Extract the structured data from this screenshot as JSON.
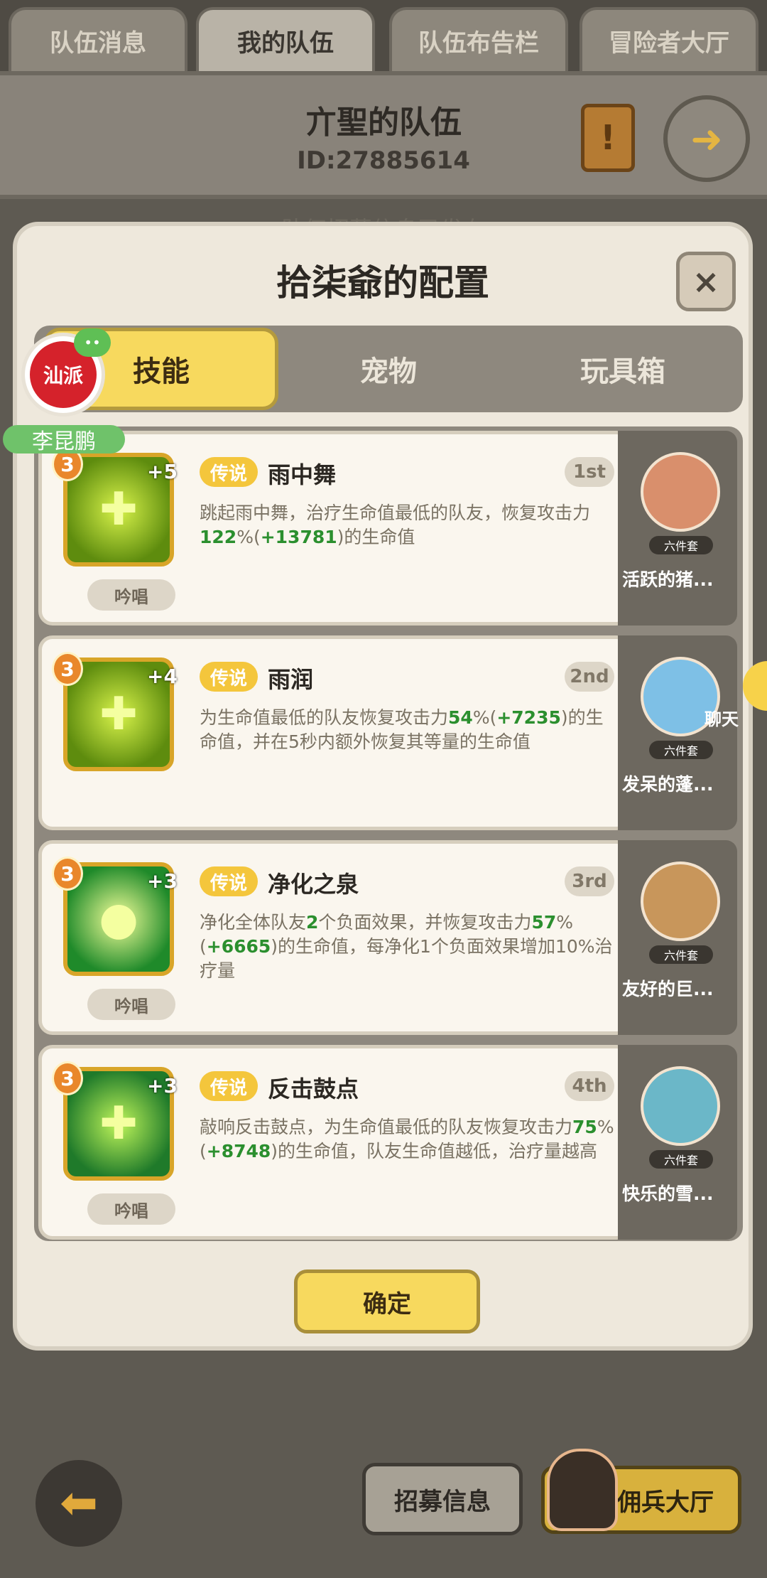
{
  "top_tabs": [
    "队伍消息",
    "我的队伍",
    "队伍布告栏",
    "冒险者大厅"
  ],
  "header": {
    "title": "亣聖的队伍",
    "id": "ID:27885614"
  },
  "faded_notice": "队伍招募信息已发布",
  "modal": {
    "title": "拾柒爺的配置",
    "close_label": "×",
    "tabs": [
      "技能",
      "宠物",
      "玩具箱"
    ],
    "skills": [
      {
        "rarity": "传说",
        "name": "雨中舞",
        "rank": "1st",
        "level": "3",
        "plus": "+5",
        "cast": "吟唱",
        "desc_parts": [
          "跳起雨中舞，治疗生命值最低的队友，恢复攻击力",
          "122",
          "%(",
          "+13781",
          ")的生命值"
        ]
      },
      {
        "rarity": "传说",
        "name": "雨润",
        "rank": "2nd",
        "level": "3",
        "plus": "+4",
        "cast": "",
        "desc_parts": [
          "为生命值最低的队友恢复攻击力",
          "54",
          "%(",
          "+7235",
          ")的生命值，并在5秒内额外恢复其等量的生命值"
        ]
      },
      {
        "rarity": "传说",
        "name": "净化之泉",
        "rank": "3rd",
        "level": "3",
        "plus": "+3",
        "cast": "吟唱",
        "desc_parts": [
          "净化全体队友",
          "2",
          "个负面效果，并恢复攻击力",
          "57",
          "%(",
          "+6665",
          ")的生命值，每净化1个负面效果增加10%治疗量"
        ]
      },
      {
        "rarity": "传说",
        "name": "反击鼓点",
        "rank": "4th",
        "level": "3",
        "plus": "+3",
        "cast": "吟唱",
        "desc_parts": [
          "敲响反击鼓点，为生命值最低的队友恢复攻击力",
          "75",
          "%(",
          "+8748",
          ")的生命值，队友生命值越低，治疗量越高"
        ]
      }
    ],
    "pets": [
      {
        "name": "活跃的猪...",
        "set_label": "六件套"
      },
      {
        "name": "发呆的蓬...",
        "set_label": "六件套"
      },
      {
        "name": "友好的巨...",
        "set_label": "六件套"
      },
      {
        "name": "快乐的雪...",
        "set_label": "六件套"
      }
    ],
    "confirm_label": "确定"
  },
  "overlay": {
    "brand_text": "汕派",
    "user_name": "李昆鹏",
    "chat_label": "聊天"
  },
  "bottom": {
    "recruit_label": "招募信息",
    "mercenary_label": "佣兵大厅"
  },
  "colors": {
    "accent_yellow": "#f7d95e",
    "highlight_green": "#2b8f2e",
    "legend_tag": "#f4c63c"
  }
}
